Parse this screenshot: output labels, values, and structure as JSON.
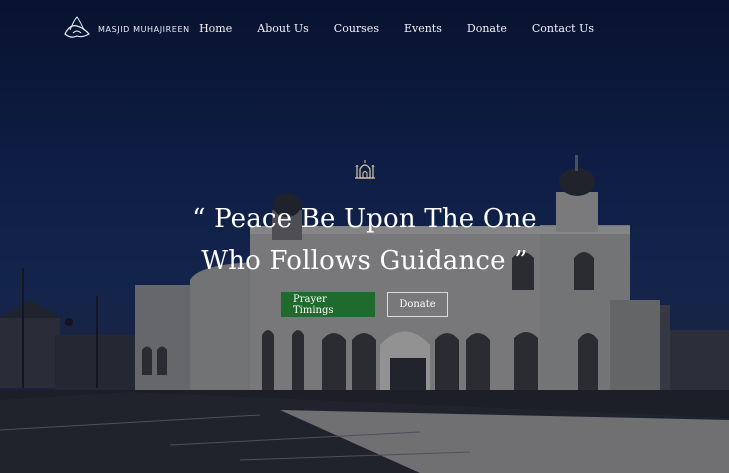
{
  "site": {
    "logo_text": "MASJID MUHAJIREEN",
    "logo_icon": "calligraphy-logo-icon"
  },
  "nav": {
    "items": [
      {
        "label": "Home"
      },
      {
        "label": "About Us"
      },
      {
        "label": "Courses"
      },
      {
        "label": "Events"
      },
      {
        "label": "Donate"
      },
      {
        "label": "Contact Us"
      }
    ]
  },
  "hero": {
    "icon": "mosque-icon",
    "quote_line1": "“ Peace Be Upon The One",
    "quote_line2": "Who Follows Guidance ”",
    "primary_button": "Prayer Timings",
    "secondary_button": "Donate"
  },
  "colors": {
    "primary_button_bg": "#1e6b2d",
    "sky": "#132552"
  }
}
